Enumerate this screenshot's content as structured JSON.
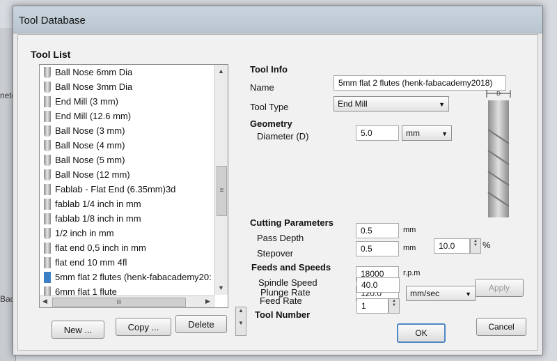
{
  "background": {
    "side_texts": [
      "nete",
      "Back"
    ]
  },
  "dialog": {
    "title": "Tool Database"
  },
  "tool_list": {
    "heading": "Tool List",
    "items": [
      {
        "label": "Ball Nose 6mm Dia",
        "icon": "ball-nose-icon"
      },
      {
        "label": "Ball Nose 3mm Dia",
        "icon": "ball-nose-icon"
      },
      {
        "label": "End Mill (3 mm)",
        "icon": "end-mill-icon"
      },
      {
        "label": "End Mill (12.6 mm)",
        "icon": "end-mill-icon"
      },
      {
        "label": "Ball Nose (3 mm)",
        "icon": "ball-nose-icon"
      },
      {
        "label": "Ball Nose (4 mm)",
        "icon": "ball-nose-icon"
      },
      {
        "label": "Ball Nose (5 mm)",
        "icon": "ball-nose-icon"
      },
      {
        "label": "Ball Nose (12 mm)",
        "icon": "ball-nose-icon"
      },
      {
        "label": "Fablab - Flat End (6.35mm)3d",
        "icon": "flat-end-icon"
      },
      {
        "label": "fablab 1/4 inch in mm",
        "icon": "flat-end-icon"
      },
      {
        "label": "fablab 1/8 inch in mm",
        "icon": "flat-end-icon"
      },
      {
        "label": "1/2 inch in mm",
        "icon": "ball-nose-icon"
      },
      {
        "label": "flat end 0,5 inch in mm",
        "icon": "flat-end-icon"
      },
      {
        "label": "flat end 10 mm 4fl",
        "icon": "flat-end-icon"
      },
      {
        "label": "5mm flat 2 flutes (henk-fabacademy20:",
        "icon": "selected-tool-icon"
      },
      {
        "label": "6mm flat 1 flute",
        "icon": "flat-end-icon"
      }
    ],
    "new_label": "New ...",
    "copy_label": "Copy ...",
    "delete_label": "Delete",
    "scroll_grip": "≡",
    "hscroll_grip": "III"
  },
  "tool_info": {
    "heading": "Tool Info",
    "name_label": "Name",
    "name_value": "5mm flat 2 flutes (henk-fabacademy2018)",
    "tool_type_label": "Tool Type",
    "tool_type_value": "End Mill",
    "geometry_label": "Geometry",
    "diameter_label": "Diameter (D)",
    "diameter_value": "5.0",
    "diameter_unit": "mm",
    "preview_label": "D"
  },
  "cutting": {
    "heading": "Cutting Parameters",
    "pass_depth_label": "Pass Depth",
    "pass_depth_value": "0.5",
    "pass_depth_unit": "mm",
    "stepover_label": "Stepover",
    "stepover_value": "0.5",
    "stepover_unit": "mm",
    "stepover_percent_value": "10.0",
    "stepover_percent_unit": "%"
  },
  "feeds": {
    "heading": "Feeds and Speeds",
    "spindle_label": "Spindle Speed",
    "spindle_value": "18000",
    "spindle_unit": "r.p.m",
    "feed_label": "Feed Rate",
    "feed_value": "120.0",
    "feed_unit": "mm/sec",
    "plunge_label": "Plunge Rate",
    "plunge_value": "40.0",
    "apply_label": "Apply"
  },
  "tool_number": {
    "label": "Tool Number",
    "value": "1"
  },
  "footer": {
    "ok_label": "OK",
    "cancel_label": "Cancel"
  }
}
